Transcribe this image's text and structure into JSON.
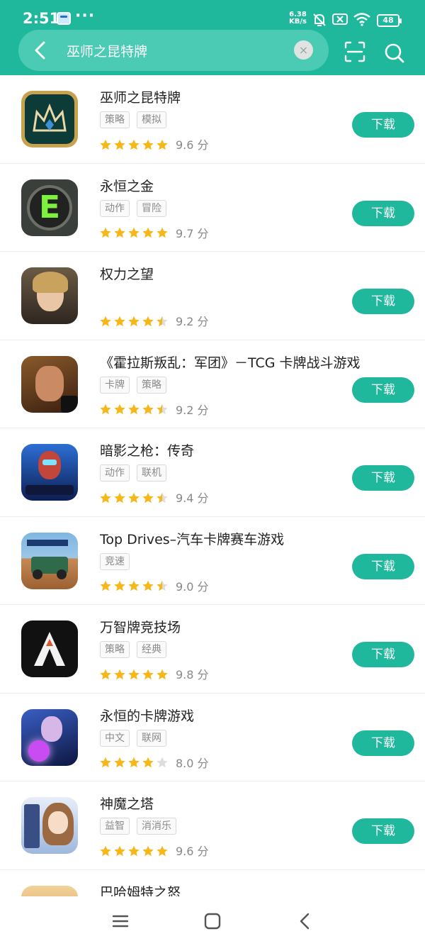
{
  "status": {
    "time": "2:51",
    "dots": "···",
    "speed_top": "6.38",
    "speed_bottom": "KB/s",
    "battery": "48",
    "icons": [
      "message-icon",
      "mute-bell-icon",
      "sim-error-icon",
      "wifi-icon",
      "battery-icon"
    ]
  },
  "search": {
    "query": "巫师之昆特牌",
    "clear_symbol": "×",
    "icons": [
      "back-arrow-icon",
      "clear-icon",
      "scan-icon",
      "search-icon"
    ]
  },
  "colors": {
    "accent": "#1fb89c",
    "star": "#f7b718",
    "star_empty": "#dddddd"
  },
  "results": [
    {
      "title": "巫师之昆特牌",
      "tags": [
        "策略",
        "模拟"
      ],
      "stars": 5,
      "score": "9.6 分",
      "button": "下载",
      "icon": "gwent-crown-icon"
    },
    {
      "title": "永恒之金",
      "tags": [
        "动作",
        "冒险"
      ],
      "stars": 5,
      "score": "9.7 分",
      "button": "下载",
      "icon": "eternium-e-icon"
    },
    {
      "title": "权力之望",
      "tags": [],
      "stars": 4.5,
      "score": "9.2 分",
      "button": "下载",
      "icon": "portrait-icon"
    },
    {
      "title": "《霍拉斯叛乱：军团》－TCG 卡牌战斗游戏",
      "tags": [
        "卡牌",
        "策略"
      ],
      "stars": 4.5,
      "score": "9.2 分",
      "button": "下载",
      "icon": "warrior-icon"
    },
    {
      "title": "暗影之枪：传奇",
      "tags": [
        "动作",
        "联机"
      ],
      "stars": 4.5,
      "score": "9.4 分",
      "button": "下载",
      "icon": "shadowgun-icon"
    },
    {
      "title": "Top Drives–汽车卡牌赛车游戏",
      "tags": [
        "竞速"
      ],
      "stars": 4.5,
      "score": "9.0 分",
      "button": "下载",
      "icon": "jeep-icon"
    },
    {
      "title": "万智牌竞技场",
      "tags": [
        "策略",
        "经典"
      ],
      "stars": 5,
      "score": "9.8 分",
      "button": "下载",
      "icon": "arena-a-icon"
    },
    {
      "title": "永恒的卡牌游戏",
      "tags": [
        "中文",
        "联网"
      ],
      "stars": 4,
      "score": "8.0 分",
      "button": "下载",
      "icon": "sorceress-icon"
    },
    {
      "title": "神魔之塔",
      "tags": [
        "益智",
        "消消乐"
      ],
      "stars": 5,
      "score": "9.6 分",
      "button": "下载",
      "icon": "anime-girl-icon"
    },
    {
      "title": "巴哈姆特之怒",
      "tags": [],
      "stars": 0,
      "score": "",
      "button": "",
      "icon": "bahamut-icon"
    }
  ],
  "navbar": {
    "icons": [
      "menu-icon",
      "home-icon",
      "back-icon"
    ]
  }
}
